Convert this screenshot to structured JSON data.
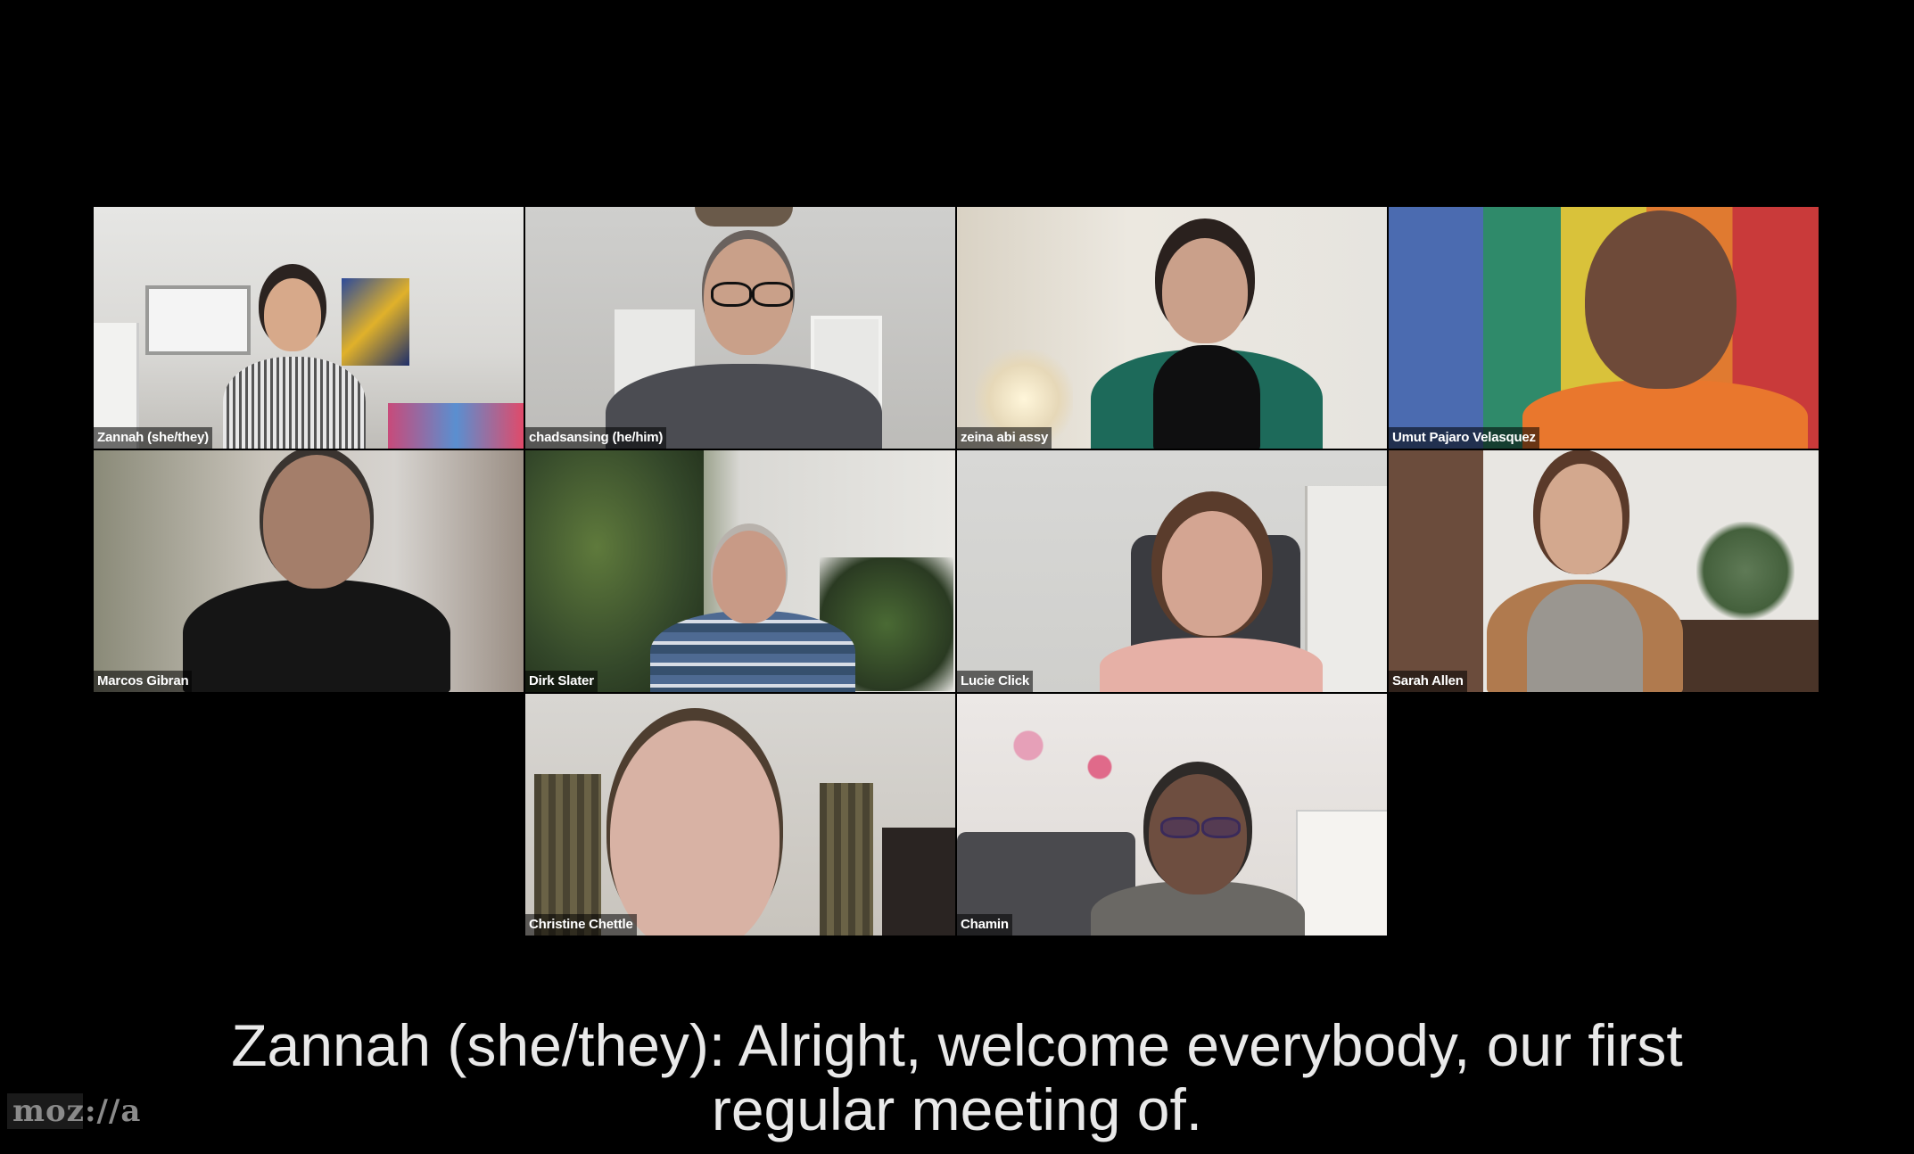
{
  "meeting": {
    "participants": [
      {
        "name": "Zannah (she/they)"
      },
      {
        "name": "chadsansing (he/him)"
      },
      {
        "name": "zeina abi assy"
      },
      {
        "name": "Umut Pajaro Velasquez"
      },
      {
        "name": "Marcos Gibran"
      },
      {
        "name": "Dirk Slater"
      },
      {
        "name": "Lucie Click"
      },
      {
        "name": "Sarah Allen"
      },
      {
        "name": "Christine Chettle"
      },
      {
        "name": "Chamin"
      }
    ]
  },
  "caption": {
    "line1": "Zannah (she/they): Alright, welcome everybody, our first",
    "line2": "regular meeting of."
  },
  "watermark": {
    "text": "moz://a"
  },
  "colors": {
    "background": "#000000",
    "caption_text": "#e9e9e9",
    "label_text": "#ffffff"
  }
}
